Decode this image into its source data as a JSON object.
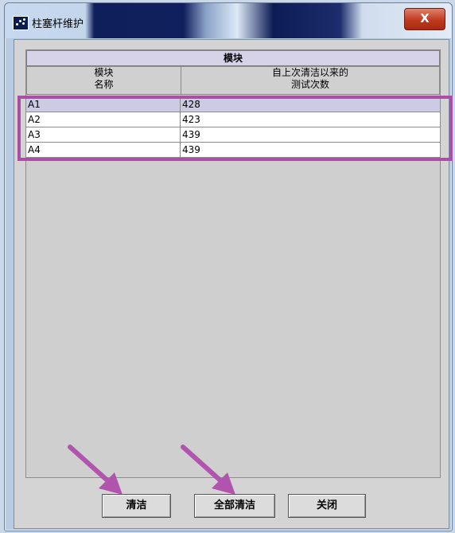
{
  "window": {
    "title": "柱塞杆维护",
    "close_symbol": "X"
  },
  "table": {
    "group_header": "模块",
    "columns": [
      {
        "line1": "模块",
        "line2": "名称"
      },
      {
        "line1": "自上次清洁以来的",
        "line2": "测试次数"
      }
    ],
    "rows": [
      {
        "module": "A1",
        "count": "428",
        "selected": true
      },
      {
        "module": "A2",
        "count": "423",
        "selected": false
      },
      {
        "module": "A3",
        "count": "439",
        "selected": false
      },
      {
        "module": "A4",
        "count": "439",
        "selected": false
      }
    ]
  },
  "buttons": {
    "clean": "清洁",
    "clean_all": "全部清洁",
    "close": "关闭"
  },
  "colors": {
    "highlight": "#a94fa4",
    "arrow": "#b054ae",
    "selected_row": "#cdcae3"
  },
  "annotations": {
    "highlight_box": "rows",
    "arrows": [
      "clean-button",
      "clean-all-button"
    ]
  }
}
